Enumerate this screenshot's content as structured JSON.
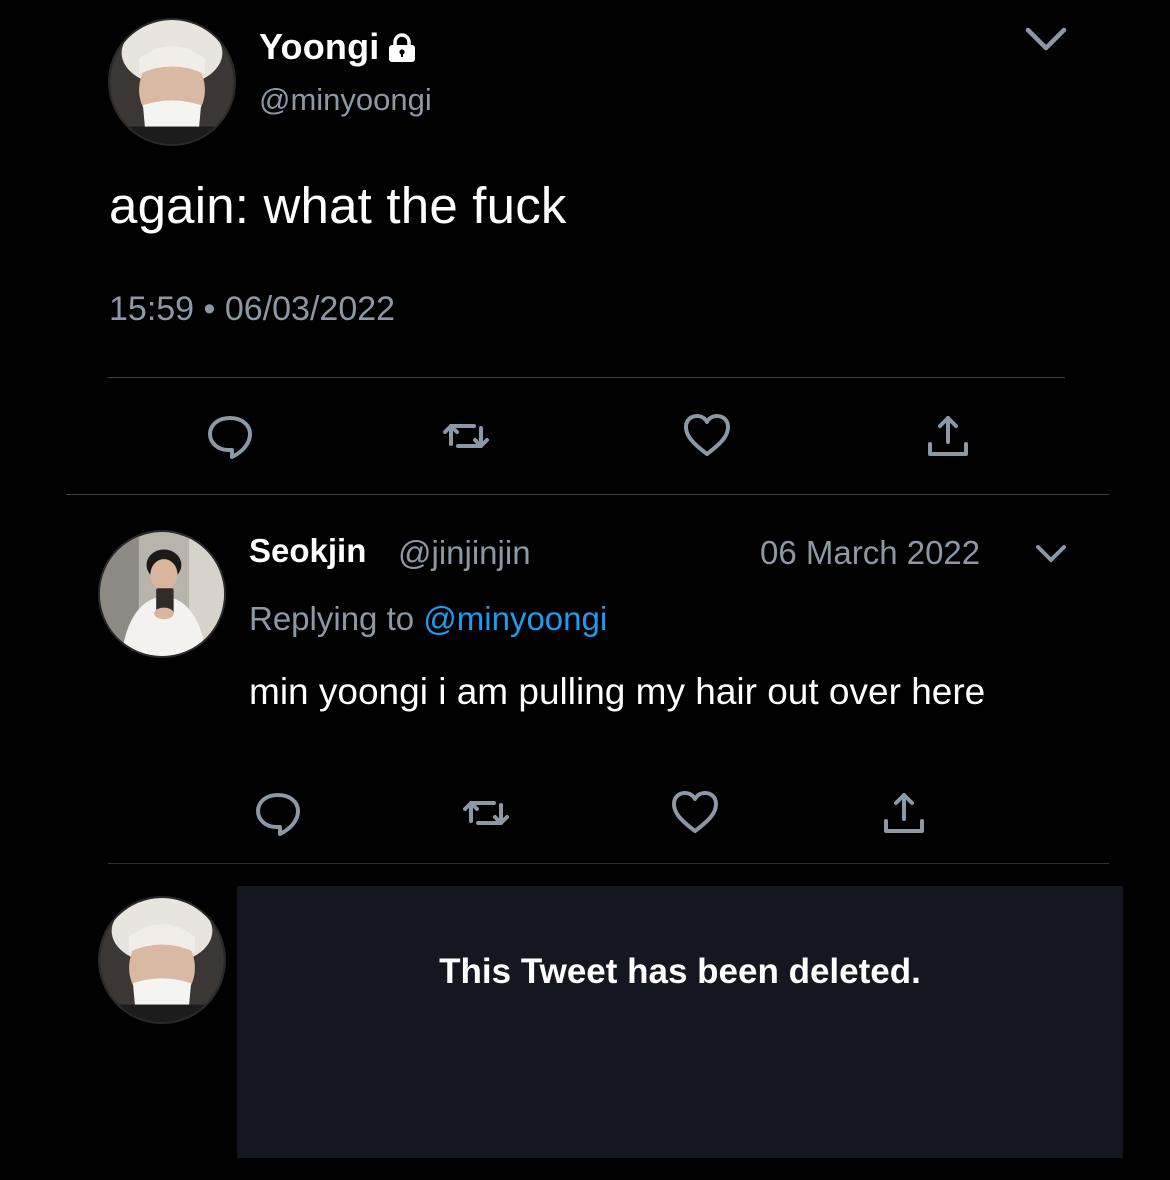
{
  "main_tweet": {
    "display_name": "Yoongi",
    "handle": "@minyoongi",
    "text": "again: what the fuck",
    "timestamp": "15:59 • 06/03/2022",
    "icons": [
      "lock-icon",
      "chevron-down-icon",
      "reply-icon",
      "retweet-icon",
      "like-icon",
      "share-icon"
    ]
  },
  "reply_tweet": {
    "display_name": "Seokjin",
    "handle": "@jinjinjin",
    "date": "06 March 2022",
    "replying_prefix": "Replying to",
    "replying_handle": "@minyoongi",
    "text": "min yoongi i am pulling my hair out over here",
    "icons": [
      "chevron-down-icon",
      "reply-icon",
      "retweet-icon",
      "like-icon",
      "share-icon"
    ]
  },
  "deleted_tweet": {
    "message": "This Tweet has been deleted."
  },
  "colors": {
    "background": "#000000",
    "secondary_text": "#8b98a5",
    "link": "#1d9bf0",
    "deleted_box": "#14171f",
    "divider": "#38444d"
  }
}
